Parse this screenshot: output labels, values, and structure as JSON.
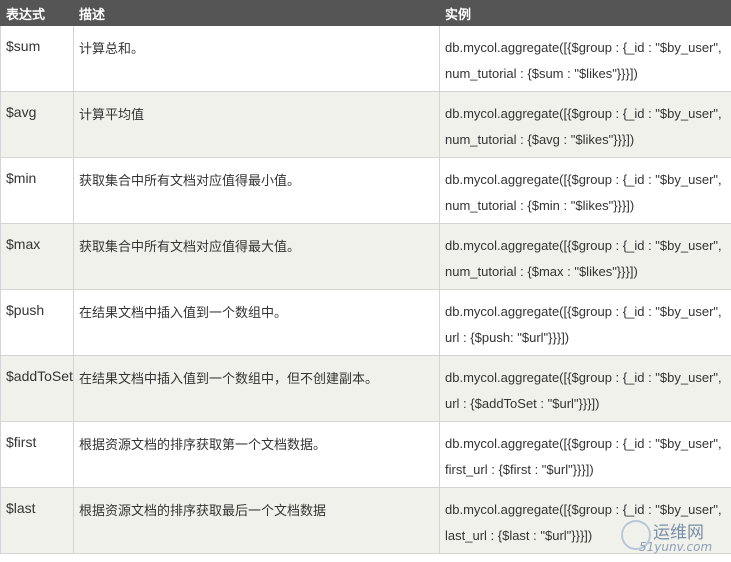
{
  "headers": [
    "表达式",
    "描述",
    "实例"
  ],
  "rows": [
    {
      "op": "$sum",
      "desc": "计算总和。",
      "ex1": "db.mycol.aggregate([{$group : {_id : \"$by_user\",",
      "ex2": "num_tutorial : {$sum : \"$likes\"}}}])"
    },
    {
      "op": "$avg",
      "desc": "计算平均值",
      "ex1": "db.mycol.aggregate([{$group : {_id : \"$by_user\",",
      "ex2": "num_tutorial : {$avg : \"$likes\"}}}])"
    },
    {
      "op": "$min",
      "desc": "获取集合中所有文档对应值得最小值。",
      "ex1": "db.mycol.aggregate([{$group : {_id : \"$by_user\",",
      "ex2": "num_tutorial : {$min : \"$likes\"}}}])"
    },
    {
      "op": "$max",
      "desc": "获取集合中所有文档对应值得最大值。",
      "ex1": "db.mycol.aggregate([{$group : {_id : \"$by_user\",",
      "ex2": "num_tutorial : {$max : \"$likes\"}}}])"
    },
    {
      "op": "$push",
      "desc": "在结果文档中插入值到一个数组中。",
      "ex1": "db.mycol.aggregate([{$group : {_id : \"$by_user\",",
      "ex2": "url : {$push: \"$url\"}}}])"
    },
    {
      "op": "$addToSet",
      "desc": "在结果文档中插入值到一个数组中，但不创建副本。",
      "ex1": "db.mycol.aggregate([{$group : {_id : \"$by_user\",",
      "ex2": "url : {$addToSet : \"$url\"}}}])"
    },
    {
      "op": "$first",
      "desc": "根据资源文档的排序获取第一个文档数据。",
      "ex1": "db.mycol.aggregate([{$group : {_id : \"$by_user\",",
      "ex2": "first_url : {$first : \"$url\"}}}])"
    },
    {
      "op": "$last",
      "desc": "根据资源文档的排序获取最后一个文档数据",
      "ex1": "db.mycol.aggregate([{$group : {_id : \"$by_user\",",
      "ex2": "last_url : {$last : \"$url\"}}}])"
    }
  ],
  "watermark": {
    "name": "运维网",
    "sub": "51yunv.com"
  }
}
